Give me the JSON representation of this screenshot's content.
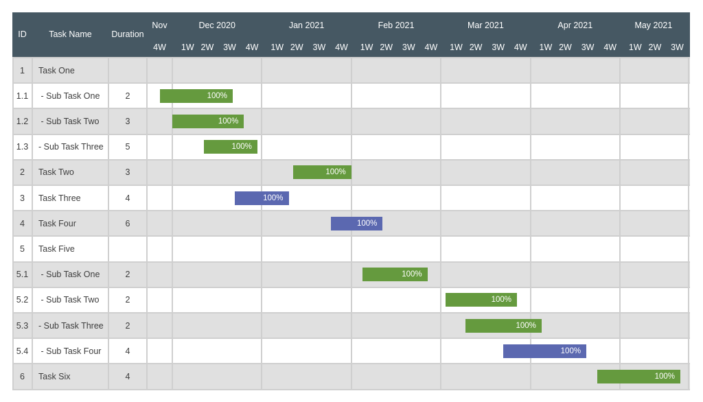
{
  "colors": {
    "header_bg": "#465863",
    "row_alt_bg": "#e0e0e0",
    "row_bg": "#ffffff",
    "grid": "#cfcfcf",
    "bar_green": "#659a3e",
    "bar_blue": "#5b68b0"
  },
  "columns": {
    "id": "ID",
    "task_name": "Task Name",
    "duration": "Duration"
  },
  "chart_data": {
    "type": "gantt",
    "title": "",
    "time_unit": "week",
    "months": [
      {
        "label": "Nov",
        "weeks": [
          "4W"
        ]
      },
      {
        "label": "Dec 2020",
        "weeks": [
          "1W",
          "2W",
          "3W",
          "4W"
        ]
      },
      {
        "label": "Jan 2021",
        "weeks": [
          "1W",
          "2W",
          "3W",
          "4W"
        ]
      },
      {
        "label": "Feb 2021",
        "weeks": [
          "1W",
          "2W",
          "3W",
          "4W"
        ]
      },
      {
        "label": "Mar 2021",
        "weeks": [
          "1W",
          "2W",
          "3W",
          "4W"
        ]
      },
      {
        "label": "Apr 2021",
        "weeks": [
          "1W",
          "2W",
          "3W",
          "4W"
        ]
      },
      {
        "label": "May 2021",
        "weeks": [
          "1W",
          "2W",
          "3W"
        ]
      }
    ],
    "tasks": [
      {
        "id": "1",
        "name": "Task One",
        "duration": "",
        "bar": null
      },
      {
        "id": "1.1",
        "name": " - Sub Task One",
        "duration": "2",
        "bar": {
          "start": 0.5,
          "end": 3.7,
          "color": "green",
          "label": "100%"
        }
      },
      {
        "id": "1.2",
        "name": " - Sub Task Two",
        "duration": "3",
        "bar": {
          "start": 1.0,
          "end": 4.2,
          "color": "green",
          "label": "100%"
        }
      },
      {
        "id": "1.3",
        "name": "- Sub Task Three",
        "duration": "5",
        "bar": {
          "start": 2.4,
          "end": 4.8,
          "color": "green",
          "label": "100%"
        }
      },
      {
        "id": "2",
        "name": "Task Two",
        "duration": "3",
        "bar": {
          "start": 6.4,
          "end": 9.0,
          "color": "green",
          "label": "100%"
        }
      },
      {
        "id": "3",
        "name": "Task Three",
        "duration": "4",
        "bar": {
          "start": 3.8,
          "end": 6.2,
          "color": "blue",
          "label": "100%"
        }
      },
      {
        "id": "4",
        "name": "Task Four",
        "duration": "6",
        "bar": {
          "start": 8.1,
          "end": 10.4,
          "color": "blue",
          "label": "100%"
        }
      },
      {
        "id": "5",
        "name": "Task Five",
        "duration": "",
        "bar": null
      },
      {
        "id": "5.1",
        "name": " - Sub Task One",
        "duration": "2",
        "bar": {
          "start": 9.5,
          "end": 12.4,
          "color": "green",
          "label": "100%"
        }
      },
      {
        "id": "5.2",
        "name": " - Sub Task Two",
        "duration": "2",
        "bar": {
          "start": 13.2,
          "end": 16.4,
          "color": "green",
          "label": "100%"
        }
      },
      {
        "id": "5.3",
        "name": "- Sub Task Three",
        "duration": "2",
        "bar": {
          "start": 14.1,
          "end": 17.5,
          "color": "green",
          "label": "100%"
        }
      },
      {
        "id": "5.4",
        "name": " - Sub Task Four",
        "duration": "4",
        "bar": {
          "start": 15.8,
          "end": 19.5,
          "color": "blue",
          "label": "100%"
        }
      },
      {
        "id": "6",
        "name": "Task Six",
        "duration": "4",
        "bar": {
          "start": 20.0,
          "end": 23.7,
          "color": "green",
          "label": "100%"
        }
      }
    ]
  }
}
